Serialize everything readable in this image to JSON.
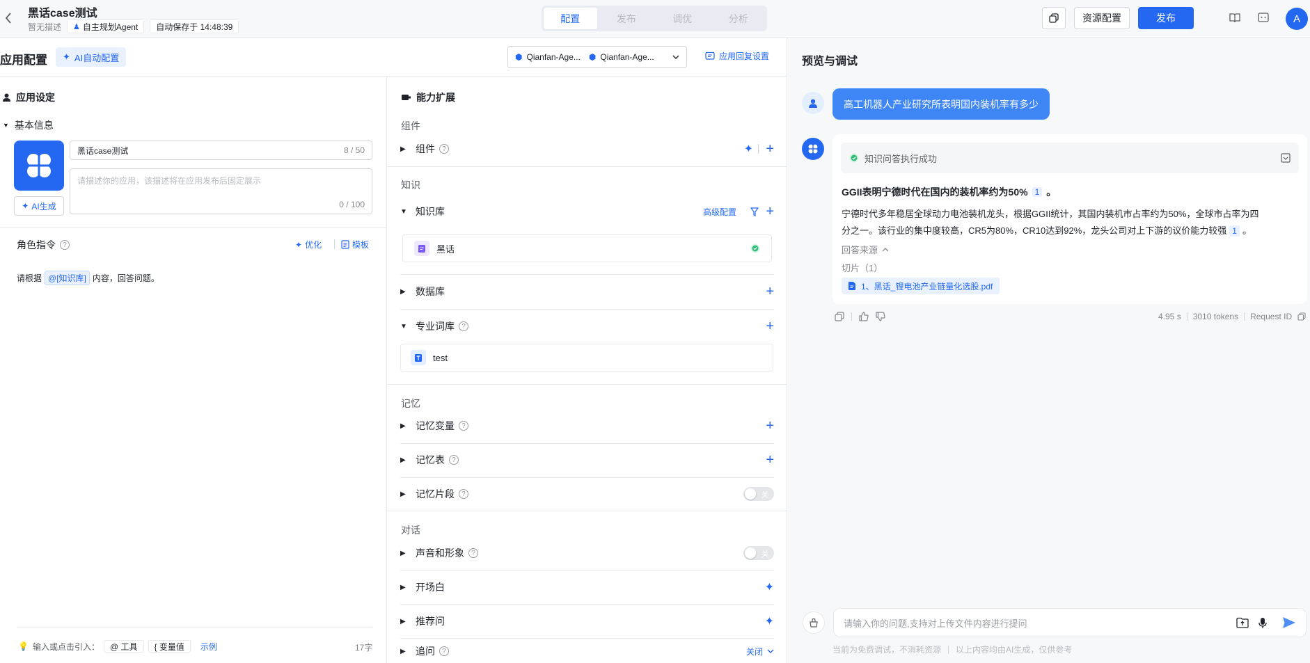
{
  "header": {
    "title": "黑话case测试",
    "no_desc": "暂无描述",
    "agent_tag": "自主规划Agent",
    "autosave": "自动保存于 14:48:39",
    "tabs": [
      "配置",
      "发布",
      "调优",
      "分析"
    ],
    "resource_btn": "资源配置",
    "publish_btn": "发布",
    "avatar": "A"
  },
  "config": {
    "title": "应用配置",
    "ai_auto": "AI自动配置",
    "model_1": "Qianfan-Age...",
    "model_2": "Qianfan-Age...",
    "reply_settings": "应用回复设置"
  },
  "app_settings": {
    "title": "应用设定",
    "basic_info": "基本信息",
    "name_value": "黑话case测试",
    "name_count": "8 / 50",
    "desc_placeholder": "请描述你的应用，该描述将在应用发布后固定展示",
    "desc_count": "0 / 100",
    "ai_generate": "AI生成",
    "role_title": "角色指令",
    "optimize": "优化",
    "template": "模板",
    "instr_prefix": "请根据",
    "instr_tag": "@[知识库]",
    "instr_suffix": "内容，回答问题。",
    "footer_hint": "输入或点击引入：",
    "tool_chip": "@ 工具",
    "var_chip": "{ 变量值",
    "example": "示例",
    "char_count": "17字"
  },
  "capability": {
    "title": "能力扩展",
    "group_components": "组件",
    "components": "组件",
    "group_knowledge": "知识",
    "kb": "知识库",
    "advanced": "高级配置",
    "kb_item": "黑话",
    "database": "数据库",
    "glossary": "专业词库",
    "glossary_item": "test",
    "group_memory": "记忆",
    "memory_var": "记忆变量",
    "memory_table": "记忆表",
    "memory_frag": "记忆片段",
    "group_dialog": "对话",
    "voice": "声音和形象",
    "opening": "开场白",
    "suggest": "推荐问",
    "followup": "追问",
    "close": "关闭",
    "toggle_off": "关"
  },
  "preview": {
    "title": "预览与调试",
    "user_msg": "高工机器人产业研究所表明国内装机率有多少",
    "status": "知识问答执行成功",
    "answer_bold": "GGII表明宁德时代在国内的装机率约为50%",
    "cite": "1",
    "answer_body_1": "宁德时代多年稳居全球动力电池装机龙头，根据GGII统计，其国内装机市占率约为50%，全球市占率为四",
    "answer_body_2": "分之一。该行业的集中度较高，CR5为80%，CR10达到92%，龙头公司对上下游的议价能力较强",
    "source_label": "回答来源",
    "slices": "切片（1）",
    "file": "1、黑话_锂电池产业链量化选股.pdf",
    "time": "4.95 s",
    "tokens": "3010 tokens",
    "request_id": "Request ID",
    "input_placeholder": "请输入你的问题,支持对上传文件内容进行提问",
    "footer_1": "当前为免费调试，不消耗资源",
    "footer_2": "以上内容均由AI生成，仅供参考"
  }
}
